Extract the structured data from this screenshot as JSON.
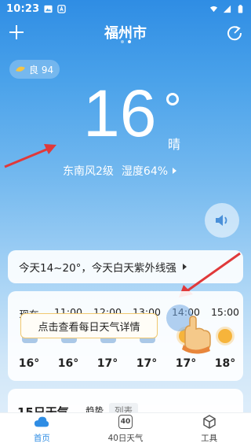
{
  "status": {
    "time": "10:23"
  },
  "header": {
    "city": "福州市"
  },
  "aqi": {
    "label": "良 94"
  },
  "current": {
    "temperature": "16",
    "condition": "晴",
    "wind": "东南风2级",
    "humidity": "湿度64%"
  },
  "summary": {
    "text": "今天14~20°，今天白天紫外线强"
  },
  "hourly": [
    {
      "time": "现在",
      "temp": "16°",
      "icon": "cloud-icon"
    },
    {
      "time": "11:00",
      "temp": "16°",
      "icon": "cloud-icon"
    },
    {
      "time": "12:00",
      "temp": "17°",
      "icon": "cloud-icon"
    },
    {
      "time": "13:00",
      "temp": "17°",
      "icon": "cloud-icon"
    },
    {
      "time": "14:00",
      "temp": "17°",
      "icon": "sun-icon"
    },
    {
      "time": "15:00",
      "temp": "18°",
      "icon": "sun-icon"
    }
  ],
  "tooltip": {
    "text": "点击查看每日天气详情"
  },
  "forecast15": {
    "title": "15日天气",
    "tab_trend": "趋势",
    "tab_list": "列表"
  },
  "nav": [
    {
      "label": "首页",
      "icon": "cloud-icon"
    },
    {
      "label": "40日天气",
      "icon": "calendar-40-icon",
      "badge": "40"
    },
    {
      "label": "工具",
      "icon": "cube-icon"
    }
  ],
  "colors": {
    "accent": "#2f8de4",
    "arrow": "#e0393a",
    "tooltip_border": "#f1c86f"
  }
}
